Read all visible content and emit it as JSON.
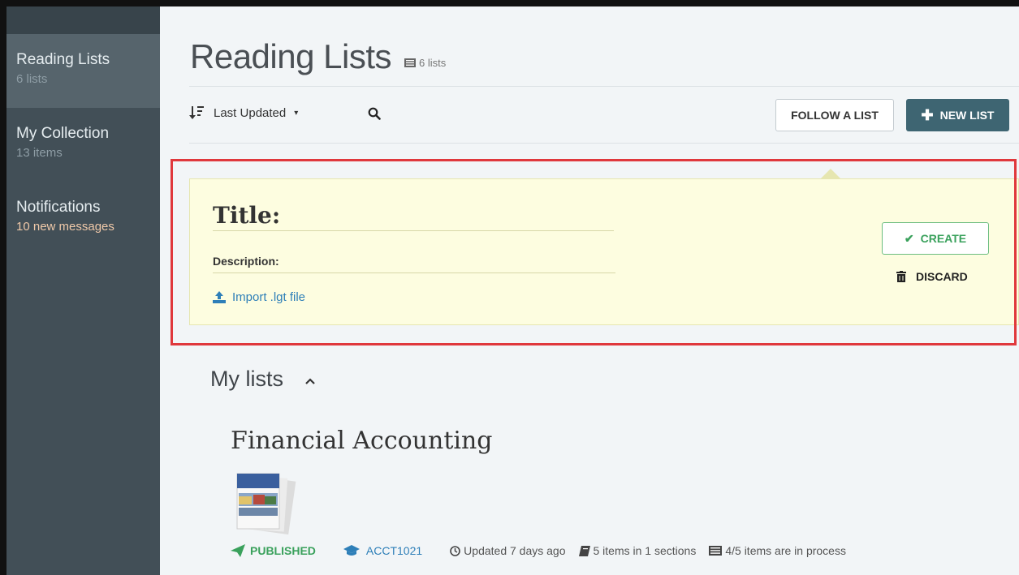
{
  "sidebar": {
    "items": [
      {
        "label": "Reading Lists",
        "sub": "6 lists",
        "active": true
      },
      {
        "label": "My Collection",
        "sub": "13 items",
        "active": false
      },
      {
        "label": "Notifications",
        "sub": "10 new messages",
        "active": false
      }
    ]
  },
  "header": {
    "title": "Reading Lists",
    "count": "6 lists"
  },
  "toolbar": {
    "sort_label": "Last Updated",
    "follow_label": "FOLLOW A LIST",
    "new_label": "NEW LIST"
  },
  "new_list_form": {
    "title_placeholder": "Title:",
    "description_placeholder": "Description:",
    "import_label": "Import .lgt file",
    "create_label": "CREATE",
    "discard_label": "DISCARD"
  },
  "my_lists": {
    "heading": "My lists",
    "lists": [
      {
        "title": "Financial Accounting",
        "status": "PUBLISHED",
        "course": "ACCT1021",
        "updated": "Updated 7 days ago",
        "items": "5 items in 1 sections",
        "process": "4/5 items are in process"
      }
    ]
  },
  "colors": {
    "sidebar_bg": "#424f57",
    "accent_dark": "#3e6572",
    "published_green": "#3aa15c",
    "link_blue": "#2e7fb8",
    "form_bg": "#fdfde0",
    "highlight_red": "#e0383c"
  },
  "icons": {
    "sort": "sort-icon",
    "search": "search-icon",
    "plus": "plus-icon",
    "upload": "upload-icon",
    "check": "check-icon",
    "trash": "trash-icon",
    "chevron": "chevron-up-icon",
    "published": "paper-plane-icon",
    "course": "graduation-cap-icon",
    "clock": "clock-icon",
    "book": "book-icon",
    "list": "list-icon"
  }
}
